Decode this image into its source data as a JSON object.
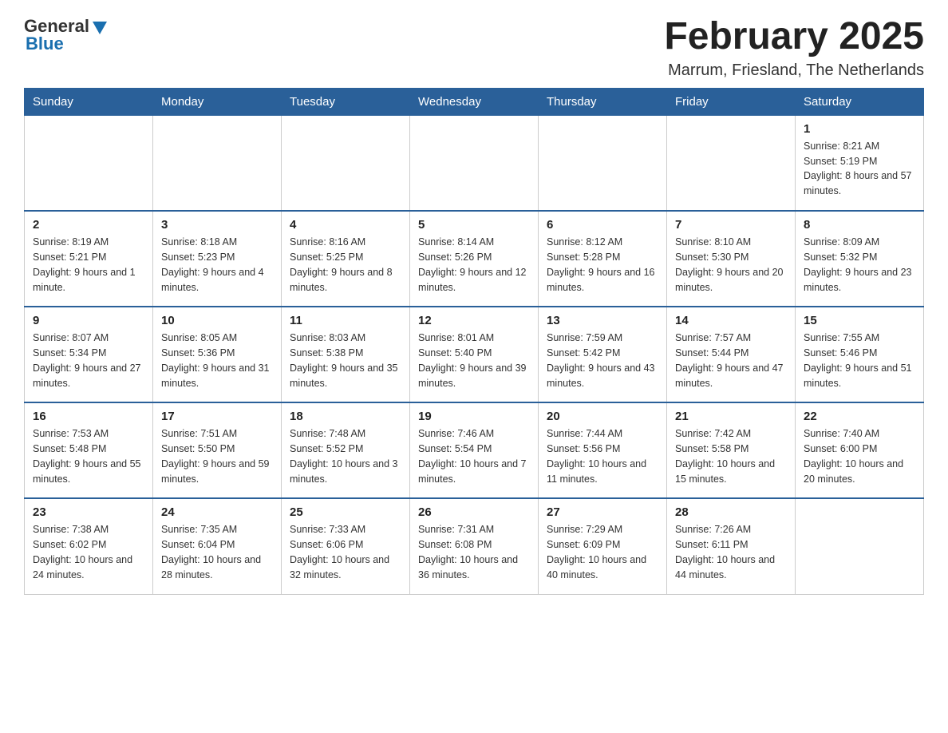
{
  "header": {
    "logo_general": "General",
    "logo_blue": "Blue",
    "month_title": "February 2025",
    "location": "Marrum, Friesland, The Netherlands"
  },
  "days_of_week": [
    "Sunday",
    "Monday",
    "Tuesday",
    "Wednesday",
    "Thursday",
    "Friday",
    "Saturday"
  ],
  "weeks": [
    [
      {
        "day": "",
        "info": ""
      },
      {
        "day": "",
        "info": ""
      },
      {
        "day": "",
        "info": ""
      },
      {
        "day": "",
        "info": ""
      },
      {
        "day": "",
        "info": ""
      },
      {
        "day": "",
        "info": ""
      },
      {
        "day": "1",
        "info": "Sunrise: 8:21 AM\nSunset: 5:19 PM\nDaylight: 8 hours and 57 minutes."
      }
    ],
    [
      {
        "day": "2",
        "info": "Sunrise: 8:19 AM\nSunset: 5:21 PM\nDaylight: 9 hours and 1 minute."
      },
      {
        "day": "3",
        "info": "Sunrise: 8:18 AM\nSunset: 5:23 PM\nDaylight: 9 hours and 4 minutes."
      },
      {
        "day": "4",
        "info": "Sunrise: 8:16 AM\nSunset: 5:25 PM\nDaylight: 9 hours and 8 minutes."
      },
      {
        "day": "5",
        "info": "Sunrise: 8:14 AM\nSunset: 5:26 PM\nDaylight: 9 hours and 12 minutes."
      },
      {
        "day": "6",
        "info": "Sunrise: 8:12 AM\nSunset: 5:28 PM\nDaylight: 9 hours and 16 minutes."
      },
      {
        "day": "7",
        "info": "Sunrise: 8:10 AM\nSunset: 5:30 PM\nDaylight: 9 hours and 20 minutes."
      },
      {
        "day": "8",
        "info": "Sunrise: 8:09 AM\nSunset: 5:32 PM\nDaylight: 9 hours and 23 minutes."
      }
    ],
    [
      {
        "day": "9",
        "info": "Sunrise: 8:07 AM\nSunset: 5:34 PM\nDaylight: 9 hours and 27 minutes."
      },
      {
        "day": "10",
        "info": "Sunrise: 8:05 AM\nSunset: 5:36 PM\nDaylight: 9 hours and 31 minutes."
      },
      {
        "day": "11",
        "info": "Sunrise: 8:03 AM\nSunset: 5:38 PM\nDaylight: 9 hours and 35 minutes."
      },
      {
        "day": "12",
        "info": "Sunrise: 8:01 AM\nSunset: 5:40 PM\nDaylight: 9 hours and 39 minutes."
      },
      {
        "day": "13",
        "info": "Sunrise: 7:59 AM\nSunset: 5:42 PM\nDaylight: 9 hours and 43 minutes."
      },
      {
        "day": "14",
        "info": "Sunrise: 7:57 AM\nSunset: 5:44 PM\nDaylight: 9 hours and 47 minutes."
      },
      {
        "day": "15",
        "info": "Sunrise: 7:55 AM\nSunset: 5:46 PM\nDaylight: 9 hours and 51 minutes."
      }
    ],
    [
      {
        "day": "16",
        "info": "Sunrise: 7:53 AM\nSunset: 5:48 PM\nDaylight: 9 hours and 55 minutes."
      },
      {
        "day": "17",
        "info": "Sunrise: 7:51 AM\nSunset: 5:50 PM\nDaylight: 9 hours and 59 minutes."
      },
      {
        "day": "18",
        "info": "Sunrise: 7:48 AM\nSunset: 5:52 PM\nDaylight: 10 hours and 3 minutes."
      },
      {
        "day": "19",
        "info": "Sunrise: 7:46 AM\nSunset: 5:54 PM\nDaylight: 10 hours and 7 minutes."
      },
      {
        "day": "20",
        "info": "Sunrise: 7:44 AM\nSunset: 5:56 PM\nDaylight: 10 hours and 11 minutes."
      },
      {
        "day": "21",
        "info": "Sunrise: 7:42 AM\nSunset: 5:58 PM\nDaylight: 10 hours and 15 minutes."
      },
      {
        "day": "22",
        "info": "Sunrise: 7:40 AM\nSunset: 6:00 PM\nDaylight: 10 hours and 20 minutes."
      }
    ],
    [
      {
        "day": "23",
        "info": "Sunrise: 7:38 AM\nSunset: 6:02 PM\nDaylight: 10 hours and 24 minutes."
      },
      {
        "day": "24",
        "info": "Sunrise: 7:35 AM\nSunset: 6:04 PM\nDaylight: 10 hours and 28 minutes."
      },
      {
        "day": "25",
        "info": "Sunrise: 7:33 AM\nSunset: 6:06 PM\nDaylight: 10 hours and 32 minutes."
      },
      {
        "day": "26",
        "info": "Sunrise: 7:31 AM\nSunset: 6:08 PM\nDaylight: 10 hours and 36 minutes."
      },
      {
        "day": "27",
        "info": "Sunrise: 7:29 AM\nSunset: 6:09 PM\nDaylight: 10 hours and 40 minutes."
      },
      {
        "day": "28",
        "info": "Sunrise: 7:26 AM\nSunset: 6:11 PM\nDaylight: 10 hours and 44 minutes."
      },
      {
        "day": "",
        "info": ""
      }
    ]
  ]
}
